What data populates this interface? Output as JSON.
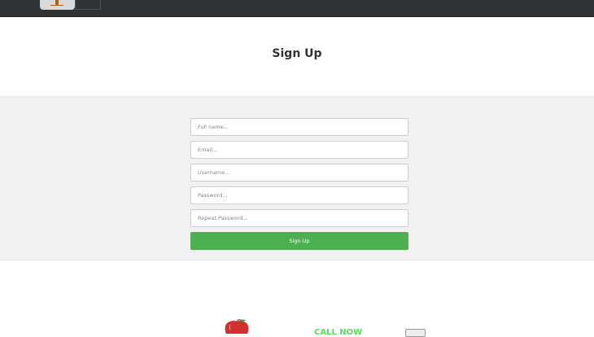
{
  "header": {
    "logo_icon": "home-logo-icon"
  },
  "page": {
    "title": "Sign Up"
  },
  "form": {
    "fullname_placeholder": "Full name...",
    "email_placeholder": "Email...",
    "username_placeholder": "Username...",
    "password_placeholder": "Password...",
    "repeat_password_placeholder": "Repeat Password...",
    "submit_label": "Sign Up"
  },
  "footer": {
    "apple_icon": "apple-icon",
    "call_now_label": "CALL NOW"
  },
  "colors": {
    "topbar": "#2f3335",
    "band": "#f1f1f1",
    "accent_green": "#4caf50",
    "call_now_green": "#5ed95e"
  }
}
